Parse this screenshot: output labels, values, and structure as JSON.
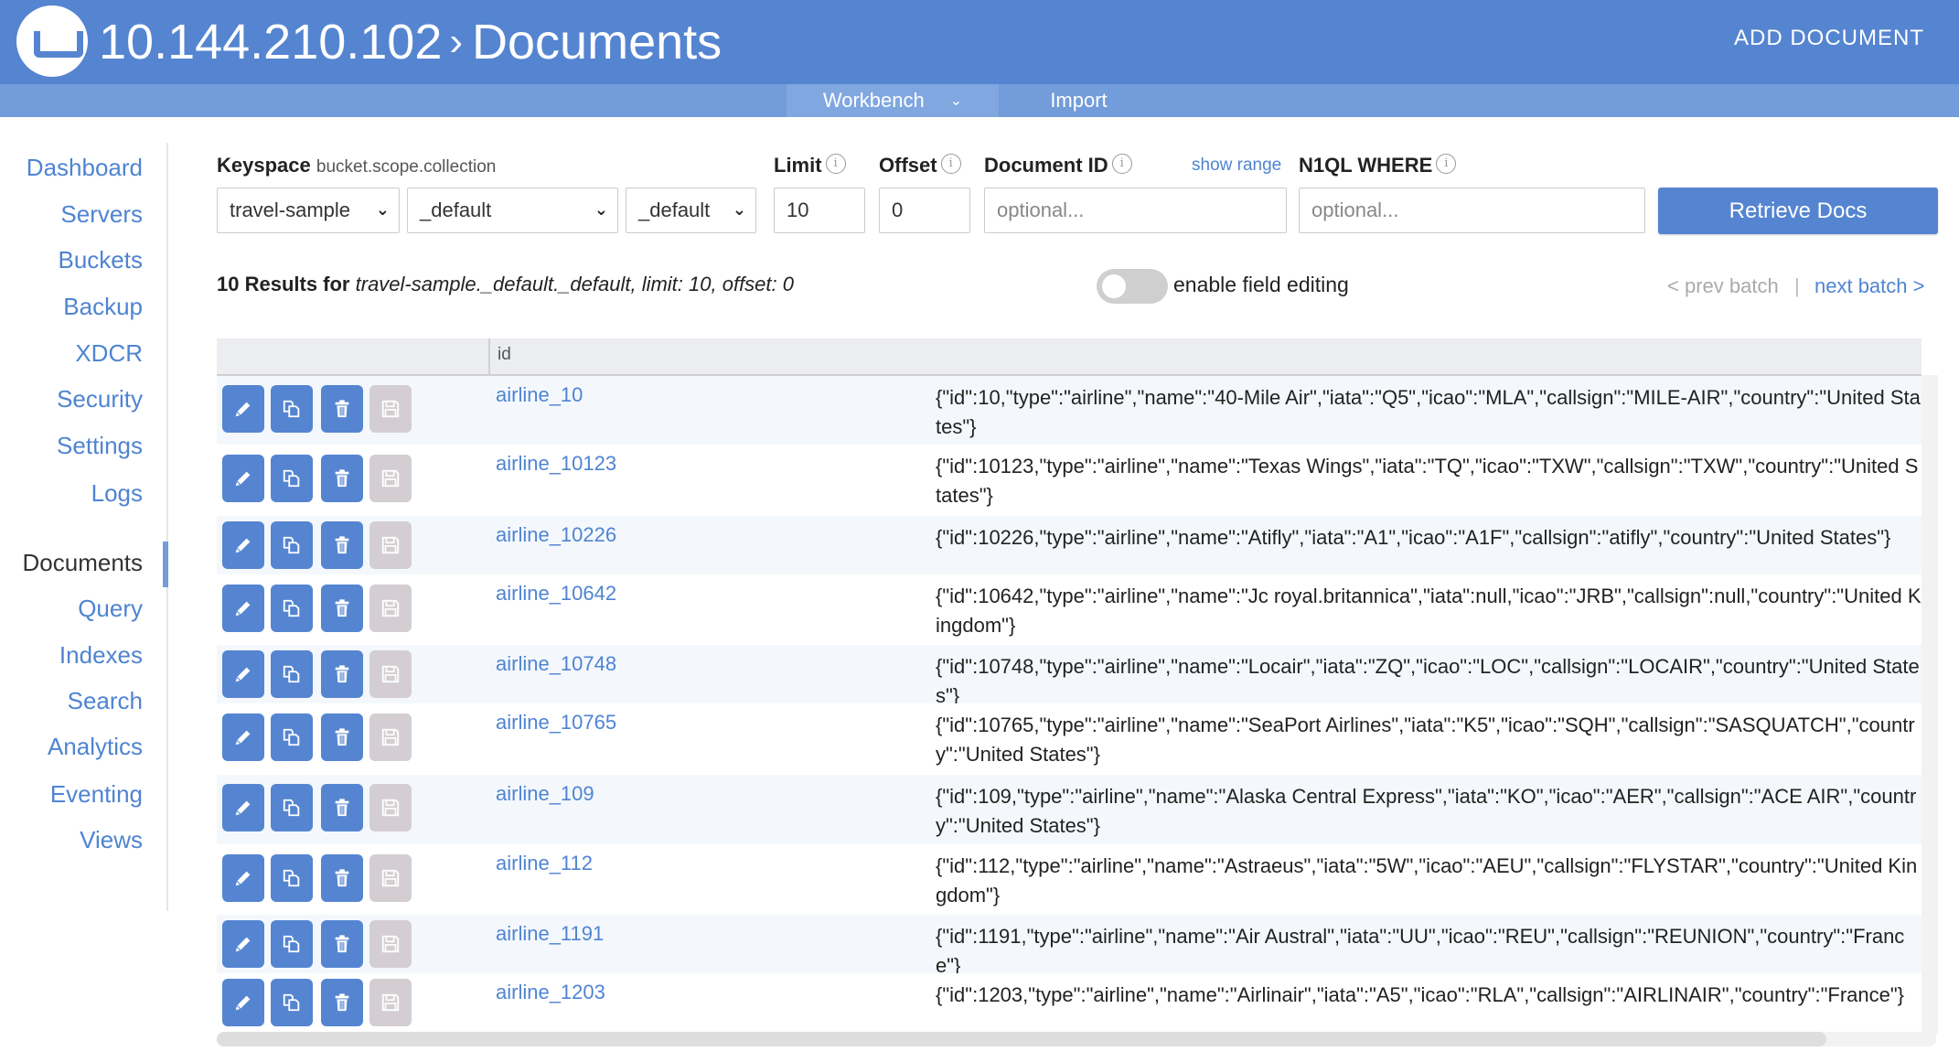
{
  "header": {
    "host": "10.144.210.102",
    "separator": "›",
    "page": "Documents",
    "add_document": "ADD DOCUMENT"
  },
  "subnav": {
    "tabs": [
      {
        "label": "Workbench",
        "active": true,
        "has_dropdown": true
      },
      {
        "label": "Import",
        "active": false
      }
    ],
    "dropdown_glyph": "⌄"
  },
  "sidebar": {
    "items": [
      {
        "label": "Dashboard",
        "active": false
      },
      {
        "label": "Servers",
        "active": false
      },
      {
        "label": "Buckets",
        "active": false
      },
      {
        "label": "Backup",
        "active": false
      },
      {
        "label": "XDCR",
        "active": false
      },
      {
        "label": "Security",
        "active": false
      },
      {
        "label": "Settings",
        "active": false
      },
      {
        "label": "Logs",
        "active": false
      },
      {
        "label": "Documents",
        "active": true
      },
      {
        "label": "Query",
        "active": false
      },
      {
        "label": "Indexes",
        "active": false
      },
      {
        "label": "Search",
        "active": false
      },
      {
        "label": "Analytics",
        "active": false
      },
      {
        "label": "Eventing",
        "active": false
      },
      {
        "label": "Views",
        "active": false
      }
    ]
  },
  "filters": {
    "keyspace_label": "Keyspace",
    "keyspace_hint": "bucket.scope.collection",
    "bucket": "travel-sample",
    "scope": "_default",
    "collection": "_default",
    "limit_label": "Limit",
    "limit_value": "10",
    "offset_label": "Offset",
    "offset_value": "0",
    "doc_id_label": "Document ID",
    "doc_id_placeholder": "optional...",
    "show_range": "show range",
    "where_label": "N1QL WHERE",
    "where_placeholder": "optional...",
    "info_glyph": "i",
    "dropdown_glyph": "⌄",
    "retrieve_button": "Retrieve Docs"
  },
  "results": {
    "count_label": "10 Results for",
    "query_desc": "travel-sample._default._default, limit: 10, offset: 0",
    "field_editing_label": "enable field editing",
    "field_editing_enabled": false,
    "prev_batch": "< prev batch",
    "batch_separator": "|",
    "next_batch": "next batch >"
  },
  "table": {
    "columns": [
      "",
      "id"
    ],
    "row_actions": [
      "edit-icon",
      "copy-icon",
      "trash-icon",
      "save-icon"
    ],
    "rows": [
      {
        "id": "airline_10",
        "doc": "{\"id\":10,\"type\":\"airline\",\"name\":\"40-Mile Air\",\"iata\":\"Q5\",\"icao\":\"MLA\",\"callsign\":\"MILE-AIR\",\"country\":\"United States\"}"
      },
      {
        "id": "airline_10123",
        "doc": "{\"id\":10123,\"type\":\"airline\",\"name\":\"Texas Wings\",\"iata\":\"TQ\",\"icao\":\"TXW\",\"callsign\":\"TXW\",\"country\":\"United States\"}"
      },
      {
        "id": "airline_10226",
        "doc": "{\"id\":10226,\"type\":\"airline\",\"name\":\"Atifly\",\"iata\":\"A1\",\"icao\":\"A1F\",\"callsign\":\"atifly\",\"country\":\"United States\"}"
      },
      {
        "id": "airline_10642",
        "doc": "{\"id\":10642,\"type\":\"airline\",\"name\":\"Jc royal.britannica\",\"iata\":null,\"icao\":\"JRB\",\"callsign\":null,\"country\":\"United Kingdom\"}"
      },
      {
        "id": "airline_10748",
        "doc": "{\"id\":10748,\"type\":\"airline\",\"name\":\"Locair\",\"iata\":\"ZQ\",\"icao\":\"LOC\",\"callsign\":\"LOCAIR\",\"country\":\"United States\"}"
      },
      {
        "id": "airline_10765",
        "doc": "{\"id\":10765,\"type\":\"airline\",\"name\":\"SeaPort Airlines\",\"iata\":\"K5\",\"icao\":\"SQH\",\"callsign\":\"SASQUATCH\",\"country\":\"United States\"}"
      },
      {
        "id": "airline_109",
        "doc": "{\"id\":109,\"type\":\"airline\",\"name\":\"Alaska Central Express\",\"iata\":\"KO\",\"icao\":\"AER\",\"callsign\":\"ACE AIR\",\"country\":\"United States\"}"
      },
      {
        "id": "airline_112",
        "doc": "{\"id\":112,\"type\":\"airline\",\"name\":\"Astraeus\",\"iata\":\"5W\",\"icao\":\"AEU\",\"callsign\":\"FLYSTAR\",\"country\":\"United Kingdom\"}"
      },
      {
        "id": "airline_1191",
        "doc": "{\"id\":1191,\"type\":\"airline\",\"name\":\"Air Austral\",\"iata\":\"UU\",\"icao\":\"REU\",\"callsign\":\"REUNION\",\"country\":\"France\"}"
      },
      {
        "id": "airline_1203",
        "doc": "{\"id\":1203,\"type\":\"airline\",\"name\":\"Airlinair\",\"iata\":\"A5\",\"icao\":\"RLA\",\"callsign\":\"AIRLINAIR\",\"country\":\"France\"}"
      }
    ]
  },
  "colors": {
    "brand": "#5585d1",
    "subnav": "#729cda",
    "link": "#4f84d2",
    "disabled_button": "#d4ced3"
  }
}
